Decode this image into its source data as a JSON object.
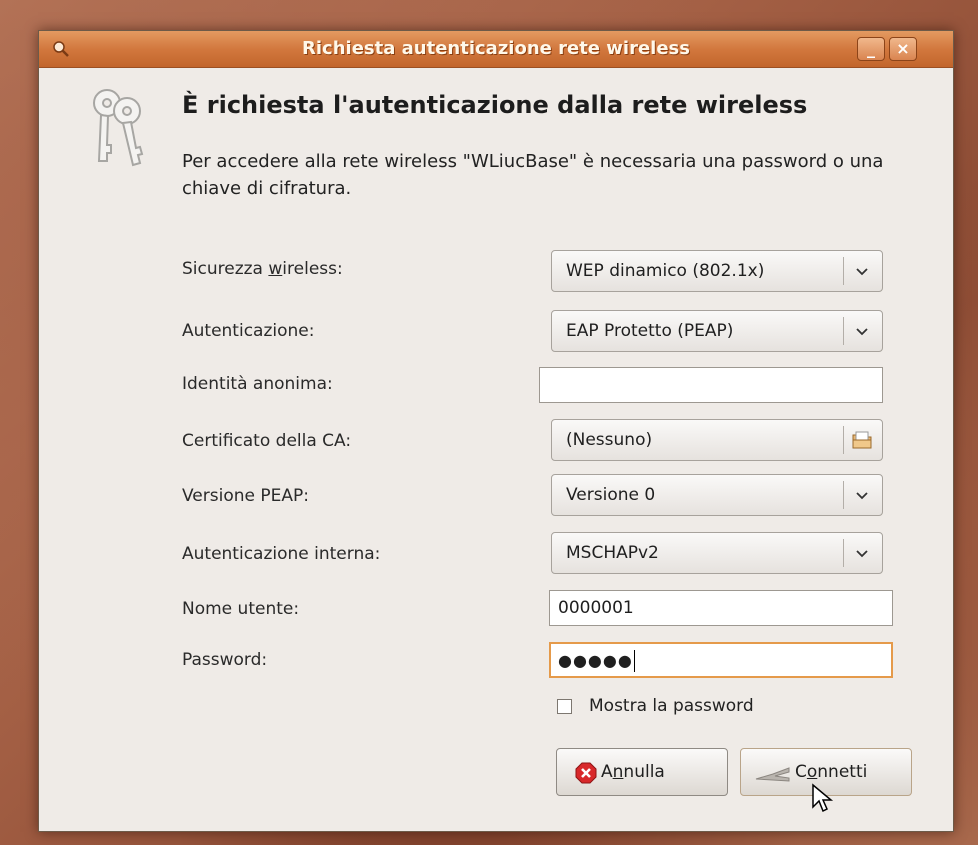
{
  "window": {
    "title": "Richiesta autenticazione rete wireless",
    "minimize_label": "_",
    "close_label": "×"
  },
  "dialog": {
    "heading": "È richiesta l'autenticazione dalla rete wireless",
    "description": "Per accedere alla rete wireless \"WLiucBase\" è necessaria una password o una chiave di cifratura."
  },
  "form": {
    "security": {
      "label_pre": "Sicurezza ",
      "label_mnemonic": "w",
      "label_post": "ireless:",
      "value": "WEP dinamico (802.1x)"
    },
    "authentication": {
      "label": "Autenticazione:",
      "value": "EAP Protetto (PEAP)"
    },
    "anonymous_identity": {
      "label": "Identità anonima:",
      "value": ""
    },
    "ca_certificate": {
      "label": "Certificato della CA:",
      "value": "(Nessuno)"
    },
    "peap_version": {
      "label": "Versione PEAP:",
      "value": "Versione 0"
    },
    "inner_auth": {
      "label": "Autenticazione interna:",
      "value": "MSCHAPv2"
    },
    "username": {
      "label": "Nome utente:",
      "value": "0000001"
    },
    "password": {
      "label": "Password:",
      "value": "●●●●●"
    },
    "show_password": {
      "label": "Mostra la password",
      "checked": false
    }
  },
  "buttons": {
    "cancel_pre": "A",
    "cancel_mnemonic": "n",
    "cancel_post": "nulla",
    "connect_pre": "C",
    "connect_mnemonic": "o",
    "connect_post": "nnetti"
  },
  "icons": {
    "title": "search-key-icon",
    "dialog": "keys-icon",
    "dropdown": "chevron-down-icon",
    "file": "folder-icon",
    "cancel": "cancel-icon",
    "connect": "network-plug-icon",
    "cursor": "mouse-pointer-icon"
  },
  "colors": {
    "titlebar": "#d2783e",
    "window_bg": "#efebe7",
    "focus_border": "#e59a4a",
    "cancel_red": "#d8282a"
  }
}
